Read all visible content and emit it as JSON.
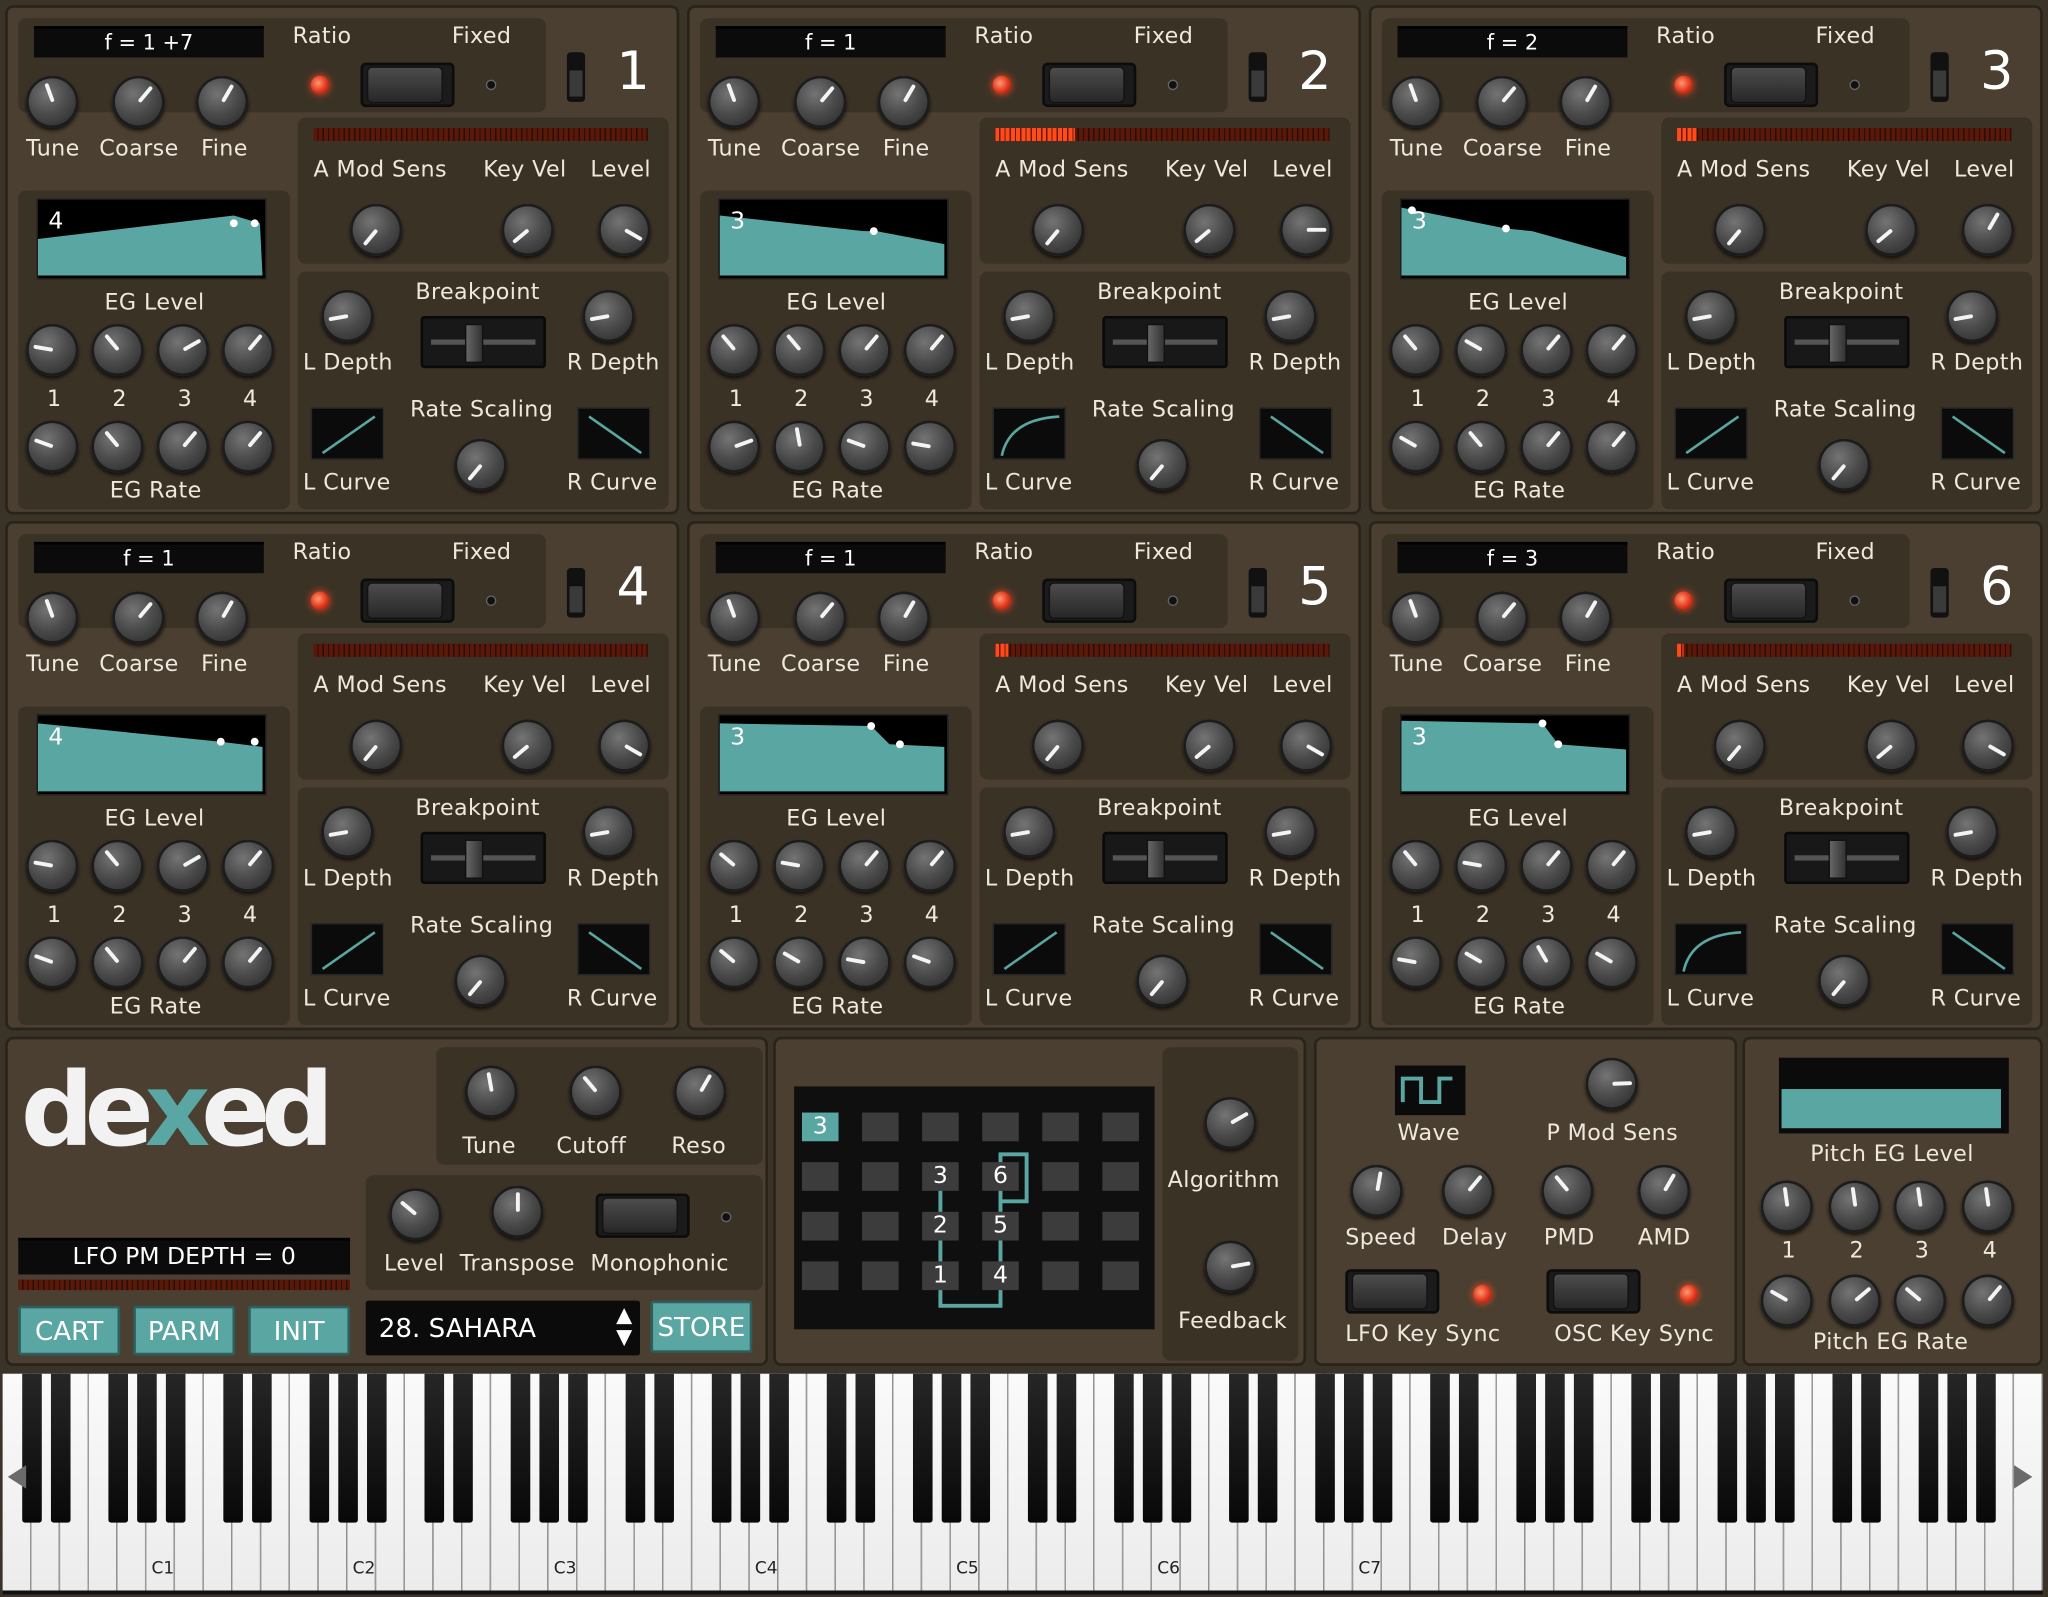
{
  "operators": [
    {
      "number": "1",
      "display": "f = 1 +7",
      "ratio": "Ratio",
      "fixed": "Fixed",
      "tune": "Tune",
      "coarse": "Coarse",
      "fine": "Fine",
      "a_mod_sens": "A Mod Sens",
      "key_vel": "Key Vel",
      "level": "Level",
      "eg_level": "EG Level",
      "eg_rate": "EG Rate",
      "eg_num": "4",
      "breakpoint": "Breakpoint",
      "l_depth": "L Depth",
      "r_depth": "R Depth",
      "rate_scaling": "Rate Scaling",
      "l_curve": "L Curve",
      "r_curve": "R Curve",
      "eg_stages": [
        "1",
        "2",
        "3",
        "4"
      ],
      "meter_level": 0
    },
    {
      "number": "2",
      "display": "f = 1",
      "ratio": "Ratio",
      "fixed": "Fixed",
      "tune": "Tune",
      "coarse": "Coarse",
      "fine": "Fine",
      "a_mod_sens": "A Mod Sens",
      "key_vel": "Key Vel",
      "level": "Level",
      "eg_level": "EG Level",
      "eg_rate": "EG Rate",
      "eg_num": "3",
      "breakpoint": "Breakpoint",
      "l_depth": "L Depth",
      "r_depth": "R Depth",
      "rate_scaling": "Rate Scaling",
      "l_curve": "L Curve",
      "r_curve": "R Curve",
      "eg_stages": [
        "1",
        "2",
        "3",
        "4"
      ],
      "meter_level": 0.24
    },
    {
      "number": "3",
      "display": "f = 2",
      "ratio": "Ratio",
      "fixed": "Fixed",
      "tune": "Tune",
      "coarse": "Coarse",
      "fine": "Fine",
      "a_mod_sens": "A Mod Sens",
      "key_vel": "Key Vel",
      "level": "Level",
      "eg_level": "EG Level",
      "eg_rate": "EG Rate",
      "eg_num": "3",
      "breakpoint": "Breakpoint",
      "l_depth": "L Depth",
      "r_depth": "R Depth",
      "rate_scaling": "Rate Scaling",
      "l_curve": "L Curve",
      "r_curve": "R Curve",
      "eg_stages": [
        "1",
        "2",
        "3",
        "4"
      ],
      "meter_level": 0.06
    },
    {
      "number": "4",
      "display": "f = 1",
      "ratio": "Ratio",
      "fixed": "Fixed",
      "tune": "Tune",
      "coarse": "Coarse",
      "fine": "Fine",
      "a_mod_sens": "A Mod Sens",
      "key_vel": "Key Vel",
      "level": "Level",
      "eg_level": "EG Level",
      "eg_rate": "EG Rate",
      "eg_num": "4",
      "breakpoint": "Breakpoint",
      "l_depth": "L Depth",
      "r_depth": "R Depth",
      "rate_scaling": "Rate Scaling",
      "l_curve": "L Curve",
      "r_curve": "R Curve",
      "eg_stages": [
        "1",
        "2",
        "3",
        "4"
      ],
      "meter_level": 0
    },
    {
      "number": "5",
      "display": "f = 1",
      "ratio": "Ratio",
      "fixed": "Fixed",
      "tune": "Tune",
      "coarse": "Coarse",
      "fine": "Fine",
      "a_mod_sens": "A Mod Sens",
      "key_vel": "Key Vel",
      "level": "Level",
      "eg_level": "EG Level",
      "eg_rate": "EG Rate",
      "eg_num": "3",
      "breakpoint": "Breakpoint",
      "l_depth": "L Depth",
      "r_depth": "R Depth",
      "rate_scaling": "Rate Scaling",
      "l_curve": "L Curve",
      "r_curve": "R Curve",
      "eg_stages": [
        "1",
        "2",
        "3",
        "4"
      ],
      "meter_level": 0.04
    },
    {
      "number": "6",
      "display": "f = 3",
      "ratio": "Ratio",
      "fixed": "Fixed",
      "tune": "Tune",
      "coarse": "Coarse",
      "fine": "Fine",
      "a_mod_sens": "A Mod Sens",
      "key_vel": "Key Vel",
      "level": "Level",
      "eg_level": "EG Level",
      "eg_rate": "EG Rate",
      "eg_num": "3",
      "breakpoint": "Breakpoint",
      "l_depth": "L Depth",
      "r_depth": "R Depth",
      "rate_scaling": "Rate Scaling",
      "l_curve": "L Curve",
      "r_curve": "R Curve",
      "eg_stages": [
        "1",
        "2",
        "3",
        "4"
      ],
      "meter_level": 0.02
    }
  ],
  "global": {
    "logo": "dexed",
    "tune": "Tune",
    "cutoff": "Cutoff",
    "reso": "Reso",
    "level": "Level",
    "transpose": "Transpose",
    "monophonic": "Monophonic",
    "display": "LFO PM DEPTH = 0",
    "cart": "CART",
    "parm": "PARM",
    "init": "INIT",
    "program": "28. SAHARA",
    "store": "STORE"
  },
  "algorithm": {
    "selected": "3",
    "label_algorithm": "Algorithm",
    "label_feedback": "Feedback",
    "ops": [
      "3",
      "6",
      "2",
      "5",
      "1",
      "4"
    ]
  },
  "lfo": {
    "wave": "Wave",
    "p_mod_sens": "P Mod Sens",
    "speed": "Speed",
    "delay": "Delay",
    "pmd": "PMD",
    "amd": "AMD",
    "lfo_key_sync": "LFO Key Sync",
    "osc_key_sync": "OSC Key Sync"
  },
  "pitch_eg": {
    "level_label": "Pitch EG Level",
    "rate_label": "Pitch EG Rate",
    "stages": [
      "1",
      "2",
      "3",
      "4"
    ]
  },
  "keyboard": {
    "octaves": [
      "C1",
      "C2",
      "C3",
      "C4",
      "C5",
      "C6",
      "C7"
    ]
  },
  "colors": {
    "accent": "#5aa6a2",
    "panel": "#4a3f30",
    "led": "#e0341b"
  }
}
